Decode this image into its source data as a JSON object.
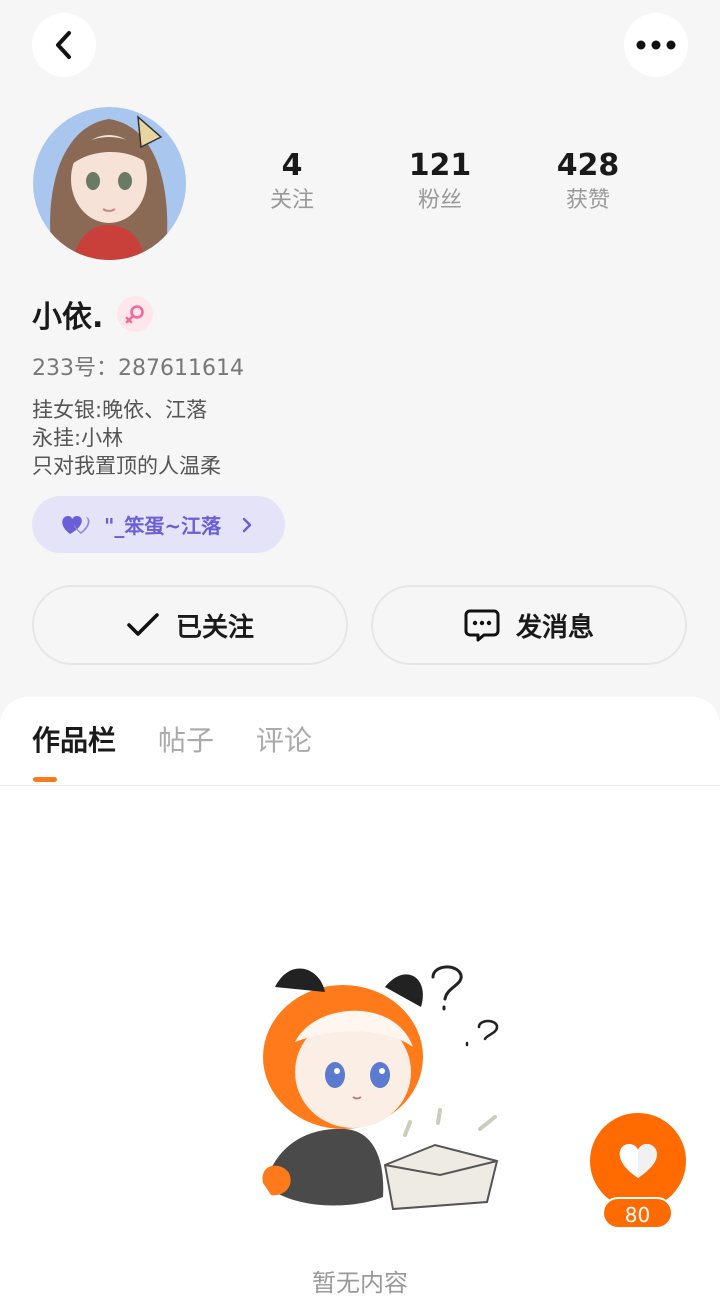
{
  "header": {
    "back_icon": "chevron-left-icon",
    "more_icon": "more-dots-icon"
  },
  "profile": {
    "name": "小依.",
    "gender": "female",
    "uid_label": "233号：",
    "uid": "287611614",
    "bio": [
      "挂女银:晚依、江落",
      "永挂:小林",
      "只对我置顶的人温柔"
    ],
    "relation_tag": "\"_笨蛋~江落"
  },
  "stats": [
    {
      "value": "4",
      "label": "关注"
    },
    {
      "value": "121",
      "label": "粉丝"
    },
    {
      "value": "428",
      "label": "获赞"
    }
  ],
  "actions": {
    "follow_label": "已关注",
    "message_label": "发消息"
  },
  "tabs": [
    {
      "label": "作品栏",
      "active": true
    },
    {
      "label": "帖子",
      "active": false
    },
    {
      "label": "评论",
      "active": false
    }
  ],
  "empty_state": {
    "text": "暂无内容"
  },
  "fab": {
    "icon": "heart-icon",
    "count": "80"
  },
  "colors": {
    "accent": "#ff6b00",
    "tag_bg": "#e5e3f8",
    "tag_text": "#6a5fd6",
    "female": "#f06a9a"
  }
}
